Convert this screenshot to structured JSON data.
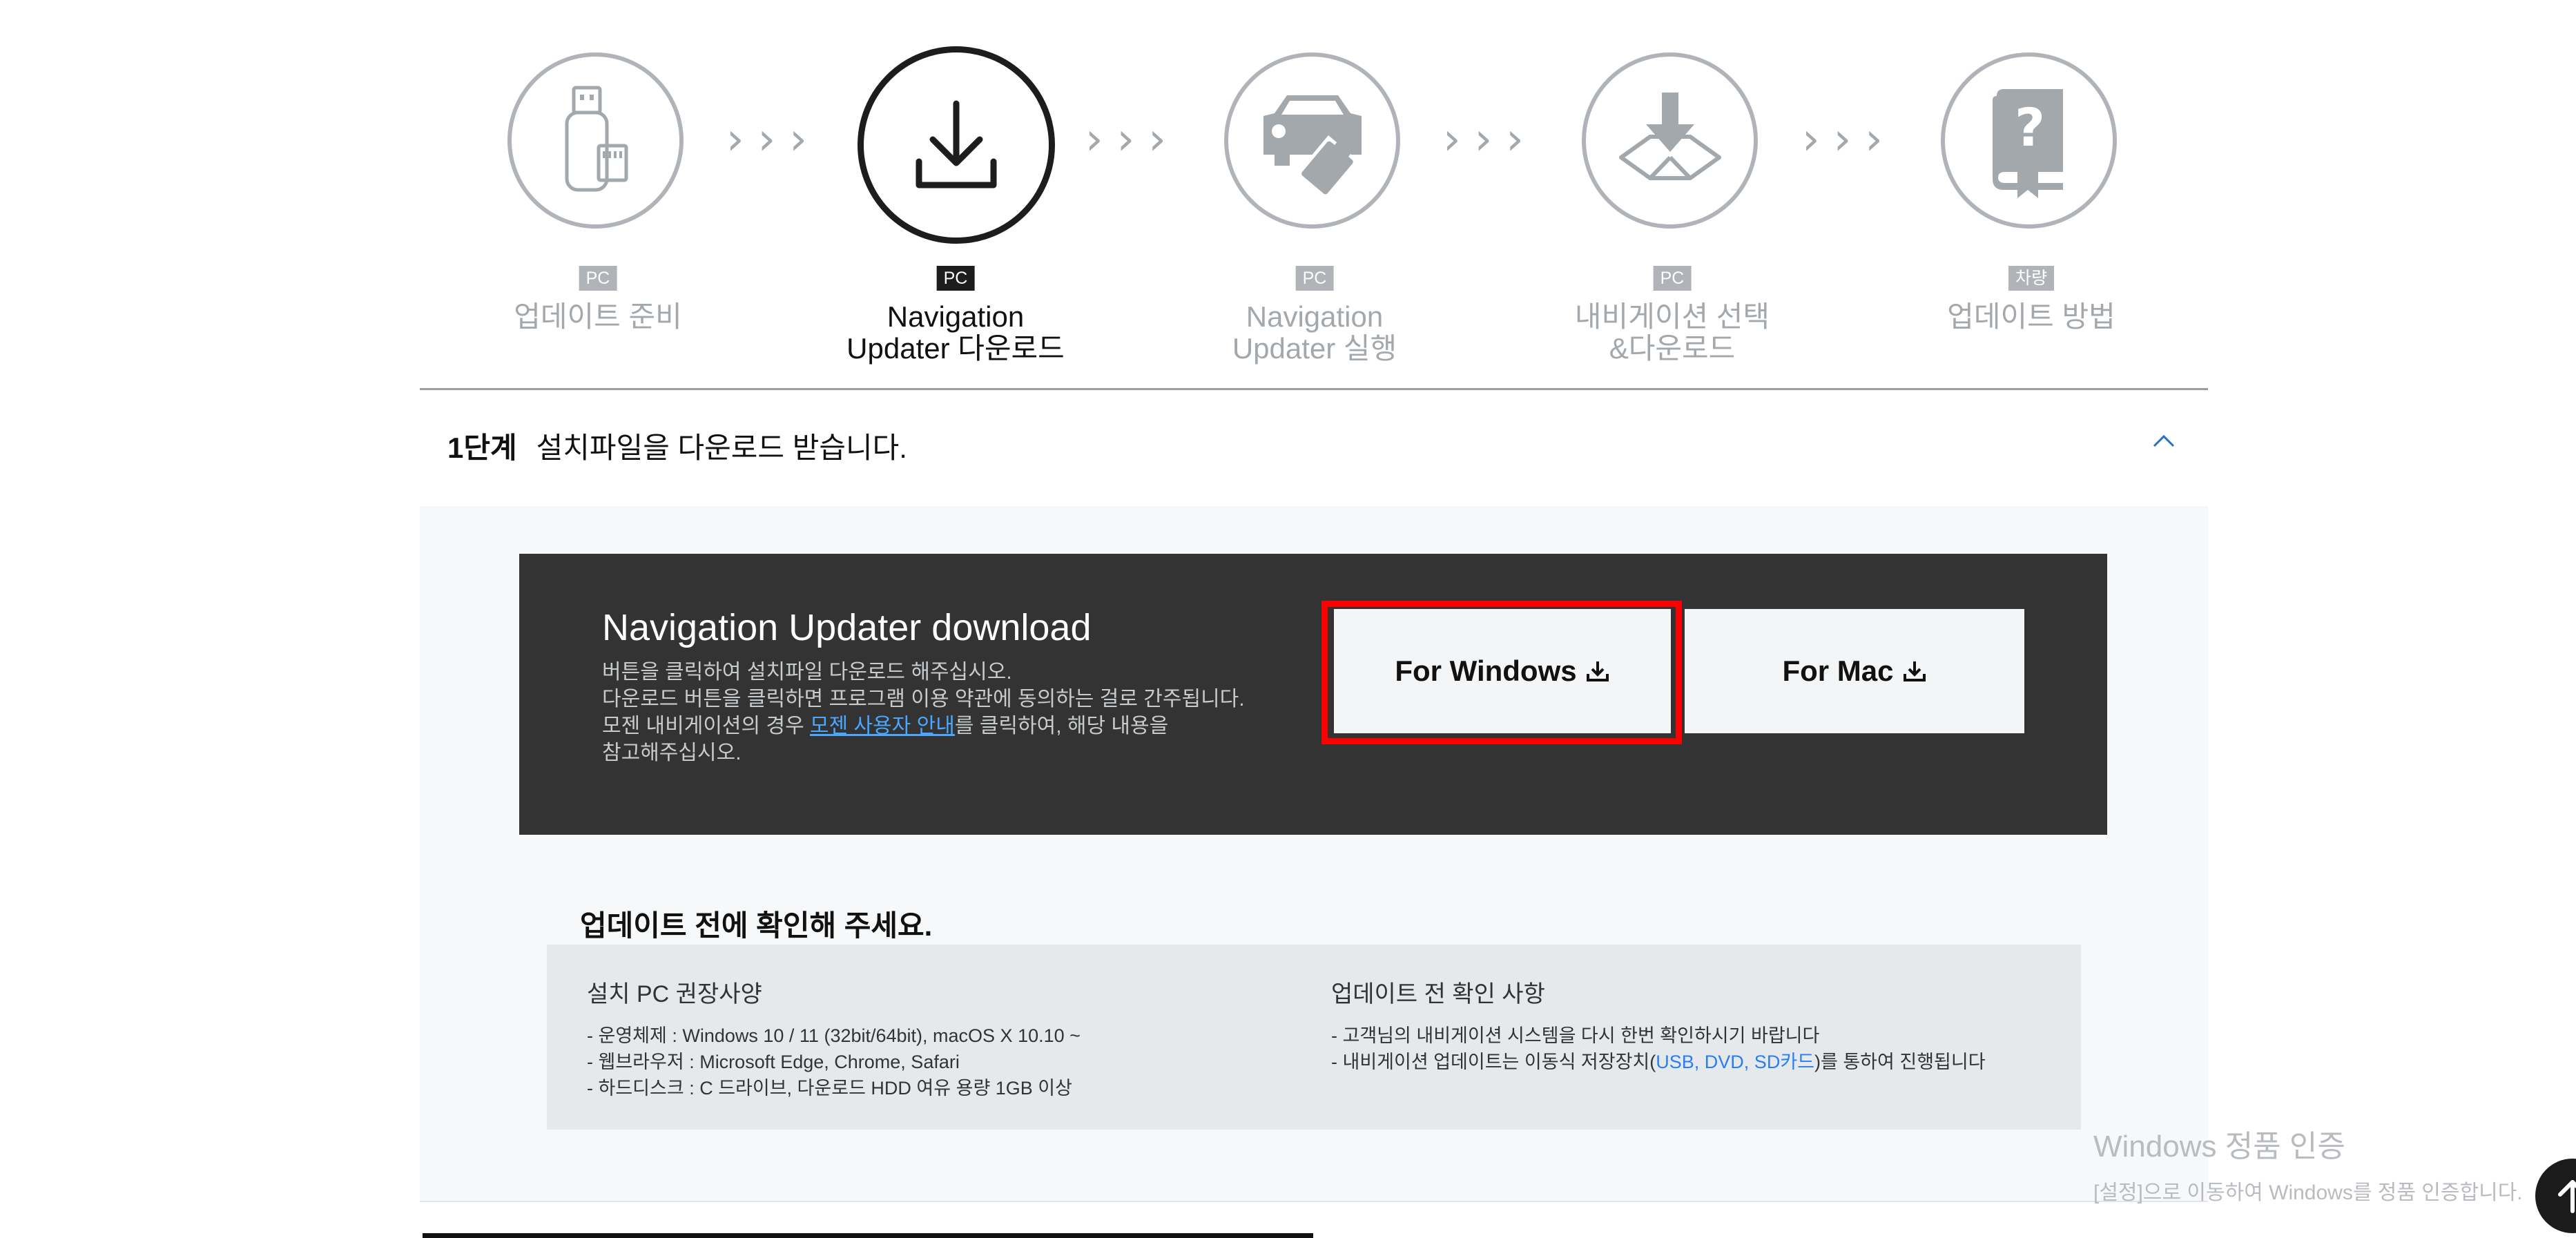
{
  "steps": [
    {
      "badge": "PC",
      "line1": "업데이트 준비",
      "line2": ""
    },
    {
      "badge": "PC",
      "line1": "Navigation",
      "line2": "Updater 다운로드"
    },
    {
      "badge": "PC",
      "line1": "Navigation",
      "line2": "Updater 실행"
    },
    {
      "badge": "PC",
      "line1": "내비게이션 선택",
      "line2": "&다운로드"
    },
    {
      "badge": "차량",
      "line1": "업데이트 방법",
      "line2": ""
    }
  ],
  "chevrons": "›››",
  "accordion": {
    "step_label": "1단계",
    "title": "설치파일을 다운로드 받습니다."
  },
  "download_panel": {
    "title_strong": "Navigation Updater",
    "title_light": "download",
    "desc_line1": "버튼을 클릭하여 설치파일 다운로드 해주십시오.",
    "desc_line2": "다운로드 버튼을 클릭하면 프로그램 이용 약관에 동의하는 걸로 간주됩니다.",
    "desc_line3_prefix": "모젠 내비게이션의 경우 ",
    "desc_link": "모젠 사용자 안내",
    "desc_line3_suffix": "를 클릭하여, 해당 내용을",
    "desc_line4": "참고해주십시오.",
    "btn_windows": "For Windows",
    "btn_mac": "For Mac",
    "accent_color": "#ff0000"
  },
  "check": {
    "title": "업데이트 전에 확인해 주세요.",
    "left": {
      "heading": "설치 PC 권장사양",
      "items": [
        "- 운영체제 : Windows 10 / 11 (32bit/64bit), macOS X 10.10 ~",
        "- 웹브라우저 : Microsoft Edge, Chrome, Safari",
        "- 하드디스크 : C 드라이브, 다운로드 HDD 여유 용량 1GB 이상"
      ]
    },
    "right": {
      "heading": "업데이트 전 확인 사항",
      "item1": "- 고객님의 내비게이션 시스템을 다시 한번 확인하시기 바랍니다",
      "item2_prefix": "- 내비게이션 업데이트는 이동식 저장장치(",
      "item2_blue": "USB, DVD, SD카드",
      "item2_suffix": ")를 통하여 진행됩니다"
    }
  },
  "watermark": {
    "line1": "Windows 정품 인증",
    "line2": "[설정]으로 이동하여 Windows를 정품 인증합니다."
  }
}
